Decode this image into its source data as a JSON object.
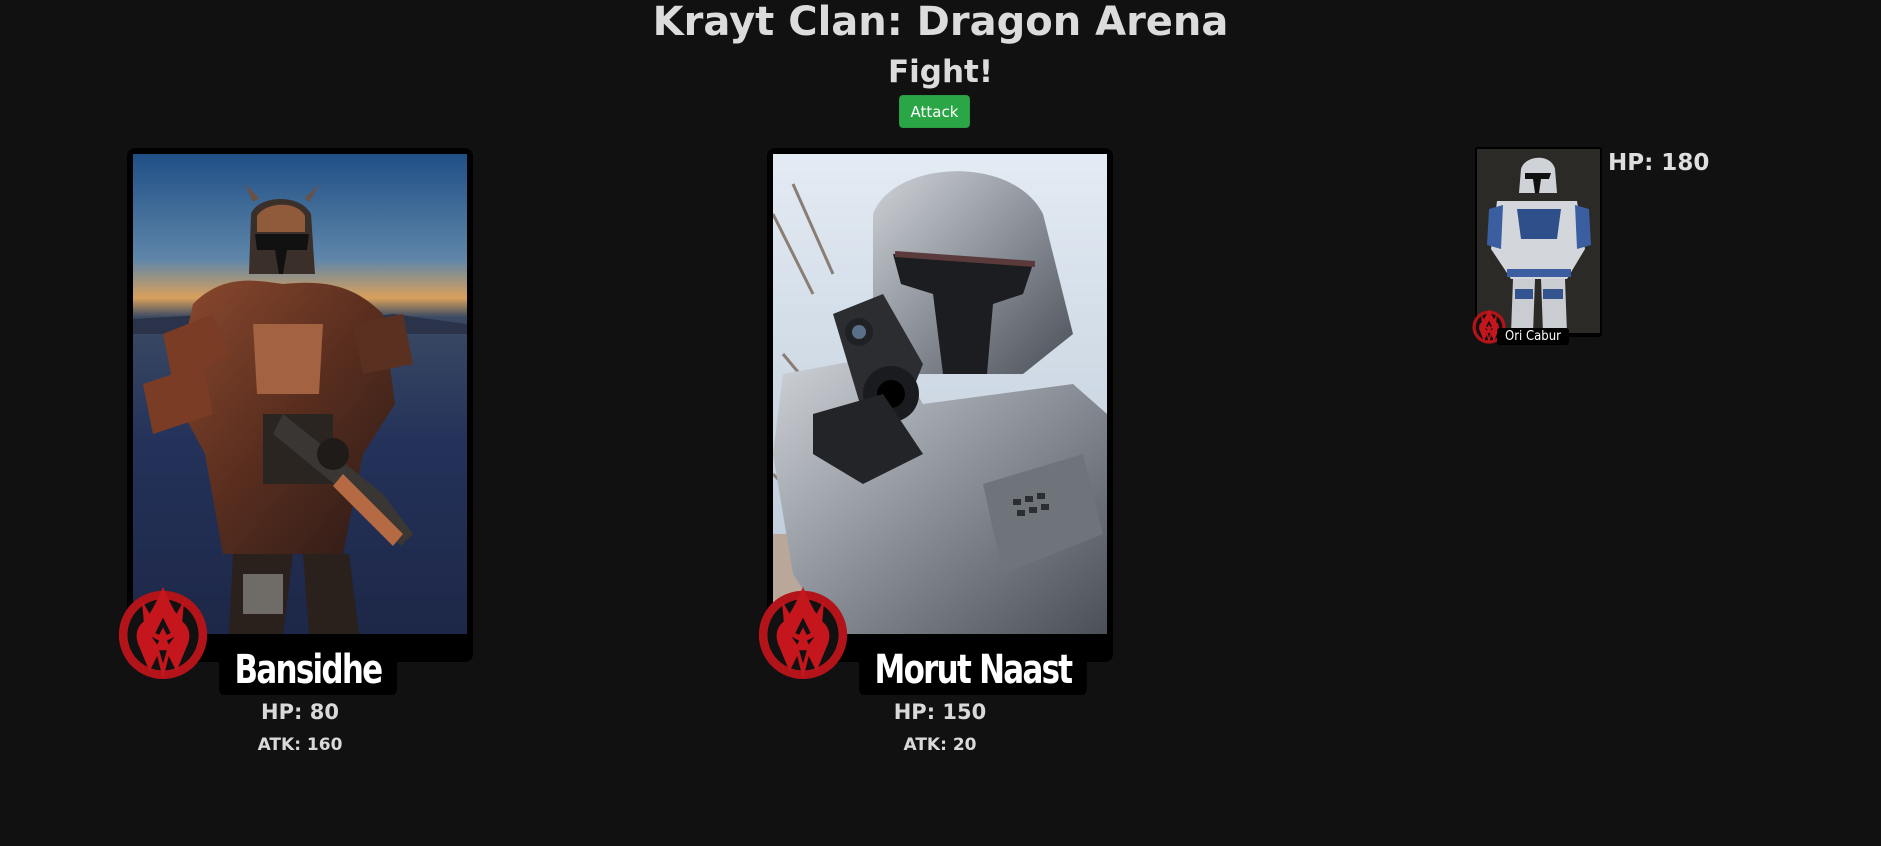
{
  "title": "Krayt Clan: Dragon Arena",
  "subtitle": "Fight!",
  "attack_label": "Attack",
  "colors": {
    "background": "#111112",
    "attack_button": "#2aa646",
    "crest": "#b3141a"
  },
  "player": {
    "name": "Bansidhe",
    "hp_label": "HP: 80",
    "atk_label": "ATK: 160",
    "crest_icon": "krayt-dragon-crest-icon"
  },
  "opponent": {
    "name": "Morut Naast",
    "hp_label": "HP: 150",
    "atk_label": "ATK: 20",
    "crest_icon": "krayt-dragon-crest-icon"
  },
  "queue": {
    "name": "Ori Cabur",
    "hp_label": "HP: 180",
    "crest_icon": "krayt-dragon-crest-icon"
  }
}
